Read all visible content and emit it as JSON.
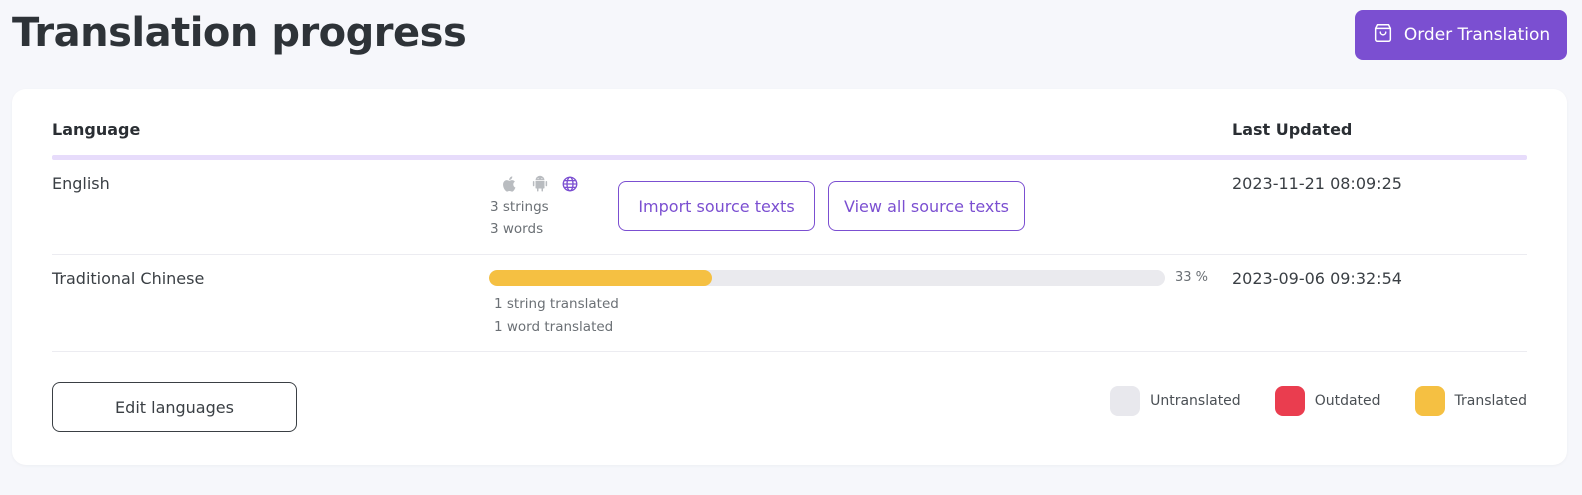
{
  "header": {
    "title": "Translation progress",
    "order_button": "Order Translation"
  },
  "table": {
    "columns": {
      "language": "Language",
      "last_updated": "Last Updated"
    },
    "rows": [
      {
        "language": "English",
        "platforms": [
          "apple-icon",
          "android-icon",
          "globe-icon"
        ],
        "strings": "3 strings",
        "words": "3 words",
        "import_button": "Import source texts",
        "view_button": "View all source texts",
        "last_updated": "2023-11-21 08:09:25"
      },
      {
        "language": "Traditional Chinese",
        "progress": 0.33,
        "progress_label": "33 %",
        "strings_translated": "1 string translated",
        "words_translated": "1 word translated",
        "last_updated": "2023-09-06 09:32:54"
      }
    ]
  },
  "footer": {
    "edit_button": "Edit languages",
    "legend": [
      {
        "label": "Untranslated",
        "color": "#e8e8ed"
      },
      {
        "label": "Outdated",
        "color": "#ea3d4f"
      },
      {
        "label": "Translated",
        "color": "#f5c042"
      }
    ]
  },
  "colors": {
    "accent": "#7b4fd1",
    "progress_fill": "#f5c042",
    "inactive_platform": "#b9bcc0"
  }
}
